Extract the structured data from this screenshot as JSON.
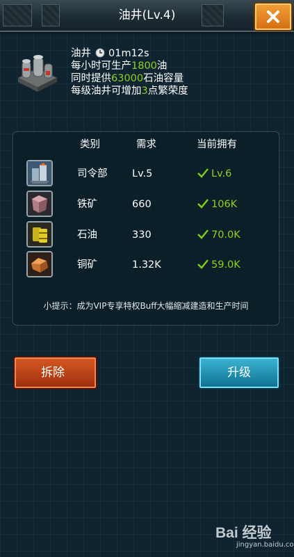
{
  "header": {
    "title": "油井(Lv.4)"
  },
  "building": {
    "name": "油井",
    "timer": "01m12s",
    "line1_pre": "每小时可生产",
    "line1_value": "1800",
    "line1_post": "油",
    "line2_pre": "同时提供",
    "line2_value": "63000",
    "line2_post": "石油容量",
    "line3_pre": "每级油井可增加",
    "line3_value": "3",
    "line3_post": "点繁荣度"
  },
  "table": {
    "headers": {
      "category": "类别",
      "required": "需求",
      "owned": "当前拥有"
    },
    "rows": [
      {
        "icon": "command-center-icon",
        "name": "司令部",
        "required": "Lv.5",
        "owned": "Lv.6"
      },
      {
        "icon": "iron-ore-icon",
        "name": "铁矿",
        "required": "660",
        "owned": "106K"
      },
      {
        "icon": "oil-barrel-icon",
        "name": "石油",
        "required": "330",
        "owned": "70.0K"
      },
      {
        "icon": "copper-ore-icon",
        "name": "铜矿",
        "required": "1.32K",
        "owned": "59.0K"
      }
    ],
    "tip": "小提示：成为VIP专享特权Buff大幅缩减建造和生产时间"
  },
  "buttons": {
    "demolish": "拆除",
    "upgrade": "升级"
  },
  "watermark": {
    "brand": "Bai 经验",
    "url": "jingyan.baidu.com"
  },
  "colors": {
    "accent_green": "#8ed21c",
    "accent_yellow": "#ffd83a",
    "close": "#e8861f",
    "demolish": "#c0441a",
    "upgrade": "#1e94b8"
  }
}
